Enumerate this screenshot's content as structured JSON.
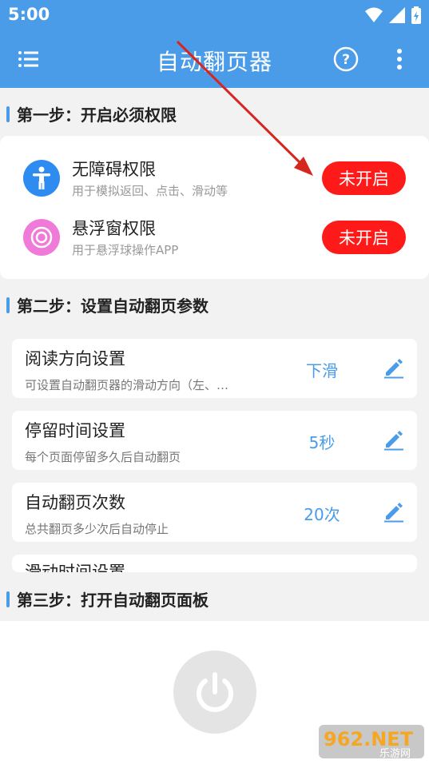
{
  "status": {
    "time": "5:00"
  },
  "appbar": {
    "title": "自动翻页器",
    "menu_icon": "menu-icon",
    "help_icon": "help-icon",
    "more_icon": "more-vert-icon"
  },
  "step1": {
    "title": "第一步：开启必须权限",
    "permissions": [
      {
        "name": "无障碍权限",
        "desc": "用于模拟返回、点击、滑动等",
        "button": "未开启",
        "icon": "accessibility-icon",
        "icon_color": "#2e8cf0"
      },
      {
        "name": "悬浮窗权限",
        "desc": "用于悬浮球操作APP",
        "button": "未开启",
        "icon": "floating-ball-icon",
        "icon_color": "#f07ad8"
      }
    ]
  },
  "step2": {
    "title": "第二步：设置自动翻页参数",
    "params": [
      {
        "name": "阅读方向设置",
        "desc": "可设置自动翻页器的滑动方向（左、…",
        "value": "下滑"
      },
      {
        "name": "停留时间设置",
        "desc": "每个页面停留多久后自动翻页",
        "value": "5秒"
      },
      {
        "name": "自动翻页次数",
        "desc": "总共翻页多少次后自动停止",
        "value": "20次"
      },
      {
        "name": "滑动时间设置",
        "desc": "",
        "value": ""
      }
    ]
  },
  "step3": {
    "title": "第三步：打开自动翻页面板",
    "power_icon": "power-icon"
  },
  "watermark": {
    "text": "962.NET",
    "sub": "乐游网"
  },
  "colors": {
    "primary": "#4a9ce8",
    "danger": "#ff1a1a",
    "annotation": "#d7261e"
  }
}
